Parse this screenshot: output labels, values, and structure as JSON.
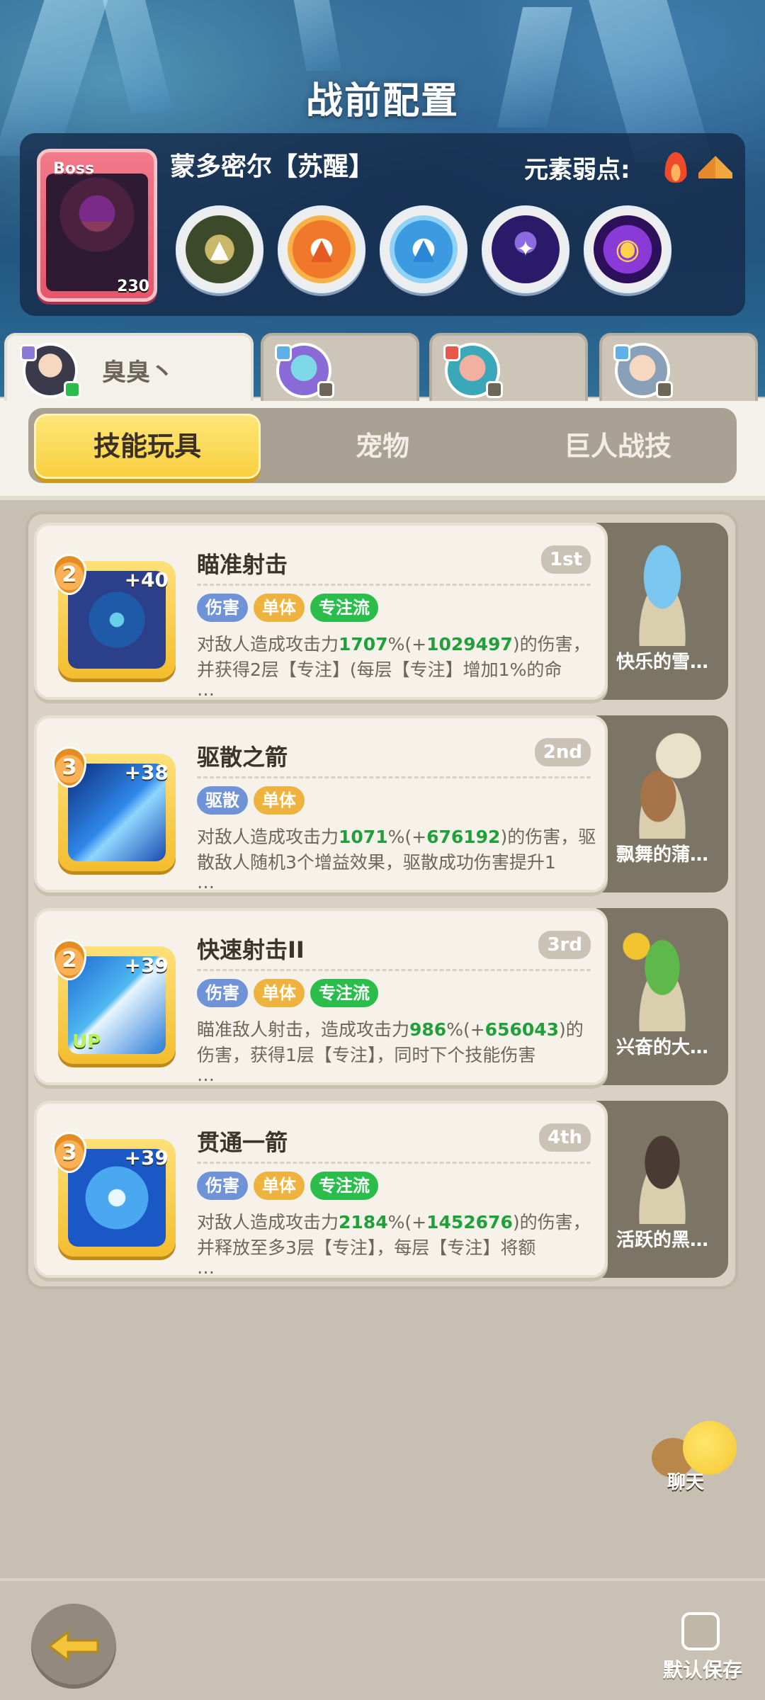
{
  "header": {
    "title": "战前配置"
  },
  "boss": {
    "tag": "Boss",
    "level": "230",
    "name": "蒙多密尔【苏醒】",
    "weakness_label": "元素弱点:",
    "weakness_icons": [
      "fire-icon",
      "earth-icon"
    ],
    "skill_icons": [
      "boss-skill-1-icon",
      "boss-skill-2-icon",
      "boss-skill-3-icon",
      "boss-skill-4-icon",
      "boss-skill-5-icon"
    ]
  },
  "heroes": [
    {
      "name": "臭臭丶",
      "active": true
    },
    {
      "name": "",
      "active": false
    },
    {
      "name": "",
      "active": false
    },
    {
      "name": "",
      "active": false
    }
  ],
  "tabs": [
    {
      "label": "技能玩具",
      "active": true
    },
    {
      "label": "宠物",
      "active": false
    },
    {
      "label": "巨人战技",
      "active": false
    }
  ],
  "skills": [
    {
      "level": "2",
      "plus": "+40",
      "title": "瞄准射击",
      "rank": "1st",
      "tags": [
        {
          "text": "伤害",
          "color": "blue"
        },
        {
          "text": "单体",
          "color": "orange"
        },
        {
          "text": "专注流",
          "color": "green"
        }
      ],
      "desc_a": "对敌人造成攻击力",
      "val1": "1707",
      "desc_b": "%(+",
      "val2": "1029497",
      "desc_c": ")的伤害，并获得2层【专注】(每层【专注】增加1%的命",
      "more": "…",
      "pet": "快乐的雪…"
    },
    {
      "level": "3",
      "plus": "+38",
      "title": "驱散之箭",
      "rank": "2nd",
      "tags": [
        {
          "text": "驱散",
          "color": "blue"
        },
        {
          "text": "单体",
          "color": "orange"
        }
      ],
      "desc_a": "对敌人造成攻击力",
      "val1": "1071",
      "desc_b": "%(+",
      "val2": "676192",
      "desc_c": ")的伤害，驱散敌人随机3个增益效果，驱散成功伤害提升1",
      "more": "…",
      "pet": "飘舞的蒲…"
    },
    {
      "level": "2",
      "plus": "+39",
      "title": "快速射击II",
      "rank": "3rd",
      "up": "UP",
      "tags": [
        {
          "text": "伤害",
          "color": "blue"
        },
        {
          "text": "单体",
          "color": "orange"
        },
        {
          "text": "专注流",
          "color": "green"
        }
      ],
      "desc_a": "瞄准敌人射击，造成攻击力",
      "val1": "986",
      "desc_b": "%(+",
      "val2": "656043",
      "desc_c": ")的伤害，获得1层【专注】，同时下个技能伤害",
      "more": "…",
      "pet": "兴奋的大…"
    },
    {
      "level": "3",
      "plus": "+39",
      "title": "贯通一箭",
      "rank": "4th",
      "tags": [
        {
          "text": "伤害",
          "color": "blue"
        },
        {
          "text": "单体",
          "color": "orange"
        },
        {
          "text": "专注流",
          "color": "green"
        }
      ],
      "desc_a": "对敌人造成攻击力",
      "val1": "2184",
      "desc_b": "%(+",
      "val2": "1452676",
      "desc_c": ")的伤害，并释放至多3层【专注】，每层【专注】将额",
      "more": "…",
      "pet": "活跃的黑…"
    }
  ],
  "chat": {
    "label": "聊天"
  },
  "footer": {
    "save_label": "默认保存"
  },
  "colors": {
    "accent_yellow": "#f8cf3e",
    "tag_blue": "#6f93d6",
    "tag_orange": "#eeb33f",
    "tag_green": "#2bbd4b",
    "highlight_green": "#21a03a"
  }
}
